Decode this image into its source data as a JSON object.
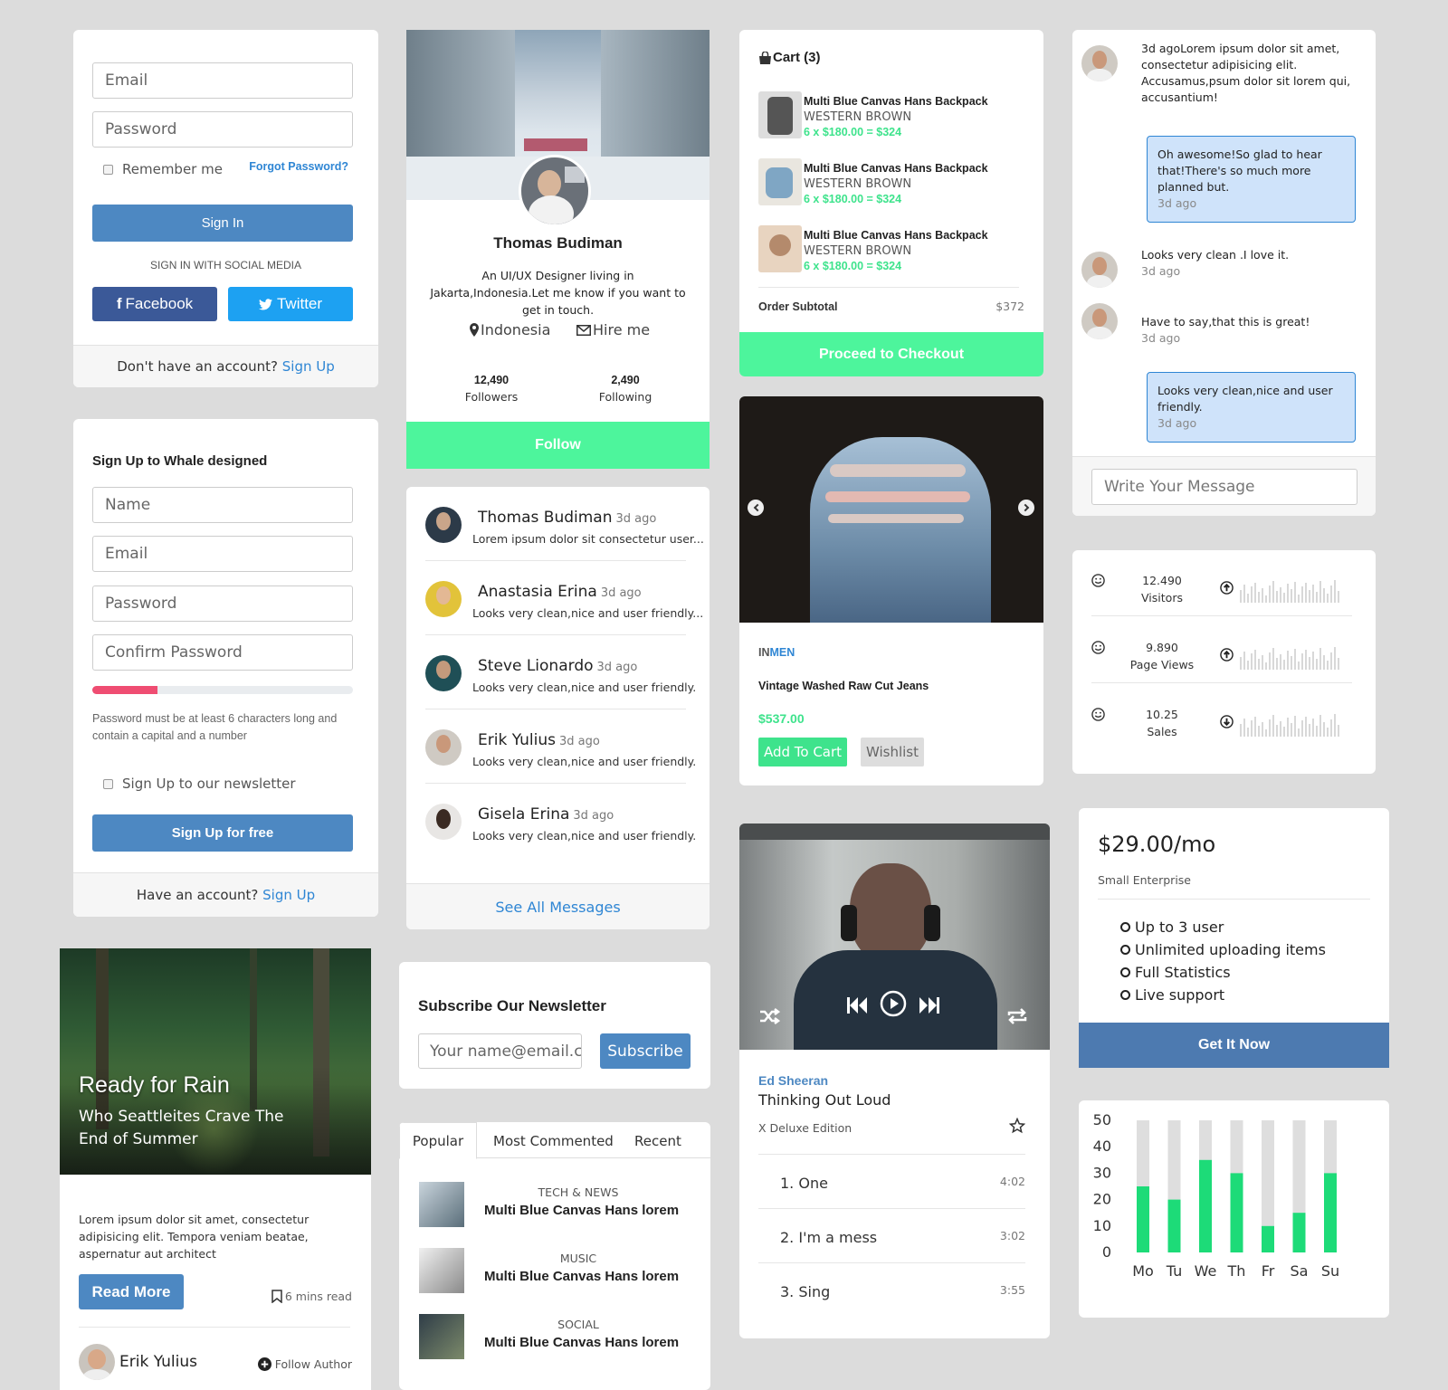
{
  "login": {
    "email_placeholder": "Email",
    "password_placeholder": "Password",
    "remember": "Remember me",
    "forgot": "Forgot Password?",
    "sign_in": "Sign In",
    "social_heading": "SIGN IN WITH SOCIAL MEDIA",
    "facebook": "Facebook",
    "twitter": "Twitter",
    "footer_text": "Don't have an account?",
    "footer_link": "Sign Up"
  },
  "signup": {
    "title": "Sign Up to Whale designed",
    "name": "Name",
    "email": "Email",
    "password": "Password",
    "confirm": "Confirm Password",
    "strength": 0.25,
    "hint": "Password must be at least 6 characters long and contain a capital and a number",
    "newsletter": "Sign Up to our newsletter",
    "submit": "Sign Up for free",
    "footer_text": "Have an account?",
    "footer_link": "Sign Up"
  },
  "blog": {
    "title": "Ready for Rain",
    "subtitle": "Who Seattleites Crave The End of Summer",
    "body": "Lorem ipsum dolor sit amet, consectetur adipisicing elit. Tempora veniam beatae, aspernatur aut architect",
    "read_more": "Read More",
    "read_time": "6 mins read",
    "author": "Erik Yulius",
    "follow": "Follow Author"
  },
  "profile": {
    "name": "Thomas Budiman",
    "bio": "An UI/UX Designer living in Jakarta,Indonesia.Let me know if you want to get in touch.",
    "location": "Indonesia",
    "hire": "Hire me",
    "followers_count": "12,490",
    "followers_label": "Followers",
    "following_count": "2,490",
    "following_label": "Following",
    "follow_button": "Follow"
  },
  "messages": {
    "items": [
      {
        "name": "Thomas Budiman",
        "time": "3d ago",
        "text": "Lorem ipsum dolor sit consectetur user..."
      },
      {
        "name": "Anastasia Erina",
        "time": "3d ago",
        "text": "Looks very clean,nice and user friendly..."
      },
      {
        "name": "Steve Lionardo",
        "time": "3d ago",
        "text": "Looks very clean,nice and user friendly."
      },
      {
        "name": "Erik Yulius",
        "time": "3d ago",
        "text": "Looks very clean,nice and user friendly."
      },
      {
        "name": "Gisela Erina",
        "time": "3d ago",
        "text": "Looks very clean,nice and user friendly."
      }
    ],
    "see_all": "See All Messages"
  },
  "newsletter": {
    "title": "Subscribe Our Newsletter",
    "placeholder": "Your name@email.co",
    "button": "Subscribe"
  },
  "posts": {
    "tabs": [
      "Popular",
      "Most Commented",
      "Recent"
    ],
    "items": [
      {
        "category": "TECH & NEWS",
        "title": "Multi Blue Canvas Hans lorem"
      },
      {
        "category": "MUSIC",
        "title": "Multi Blue Canvas Hans lorem"
      },
      {
        "category": "SOCIAL",
        "title": "Multi Blue Canvas Hans lorem"
      }
    ]
  },
  "cart": {
    "title": "Cart (3)",
    "items": [
      {
        "title": "Multi Blue Canvas Hans Backpack",
        "variant": "WESTERN BROWN",
        "price": "6 x $180.00 = $324"
      },
      {
        "title": "Multi Blue Canvas Hans Backpack",
        "variant": "WESTERN BROWN",
        "price": "6 x $180.00 = $324"
      },
      {
        "title": "Multi Blue Canvas Hans Backpack",
        "variant": "WESTERN BROWN",
        "price": "6 x $180.00 = $324"
      }
    ],
    "subtotal_label": "Order Subtotal",
    "subtotal": "$372",
    "checkout": "Proceed to Checkout"
  },
  "product": {
    "brand_a": "IN",
    "brand_b": "MEN",
    "name": "Vintage Washed Raw Cut Jeans",
    "price": "$537.00",
    "add": "Add To Cart",
    "wishlist": "Wishlist"
  },
  "player": {
    "artist": "Ed Sheeran",
    "song": "Thinking Out Loud",
    "edition": "X Deluxe Edition",
    "tracks": [
      {
        "name": "1. One",
        "duration": "4:02"
      },
      {
        "name": "2. I'm a mess",
        "duration": "3:02"
      },
      {
        "name": "3. Sing",
        "duration": "3:55"
      }
    ]
  },
  "chat": {
    "items": [
      {
        "side": "left",
        "text": "3d agoLorem ipsum dolor sit amet, consectetur adipisicing elit. Accusamus,psum dolor sit lorem qui, accusantium!",
        "time": ""
      },
      {
        "side": "right",
        "text": "Oh awesome!So glad to hear that!There's so much more planned but.",
        "time": "3d ago"
      },
      {
        "side": "left",
        "text": "Looks very clean .I love it.",
        "time": "3d ago"
      },
      {
        "side": "left",
        "text": "Have to say,that this is great!",
        "time": "3d ago"
      },
      {
        "side": "right",
        "text": "Looks very clean,nice and user friendly.",
        "time": "3d ago"
      }
    ],
    "placeholder": "Write Your Message"
  },
  "stats": [
    {
      "value": "12.490",
      "label": "Visitors"
    },
    {
      "value": "9.890",
      "label": "Page Views"
    },
    {
      "value": "10.25",
      "label": "Sales"
    }
  ],
  "pricing": {
    "price": "$29.00/mo",
    "plan": "Small Enterprise",
    "features": [
      "Up to 3 user",
      "Unlimited uploading items",
      "Full Statistics",
      "Live support"
    ],
    "button": "Get It Now"
  },
  "chart_data": {
    "type": "bar",
    "categories": [
      "Mo",
      "Tu",
      "We",
      "Th",
      "Fr",
      "Sa",
      "Su"
    ],
    "values": [
      25,
      20,
      35,
      30,
      10,
      15,
      30
    ],
    "ylim": [
      0,
      50
    ],
    "yticks": [
      50,
      40,
      30,
      20,
      10,
      0
    ],
    "bar_color": "#1ddb78",
    "track_color": "#dedede"
  },
  "colors": {
    "primary": "#4d88c2",
    "accent_green": "#4df59c",
    "facebook": "#3b5998",
    "twitter": "#1da1f2",
    "link": "#2f86d4"
  }
}
